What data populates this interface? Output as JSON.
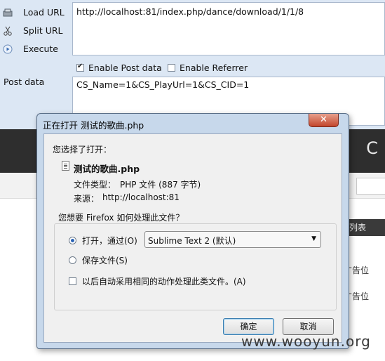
{
  "hackbar": {
    "items": [
      {
        "label": "Load URL"
      },
      {
        "label": "Split URL"
      },
      {
        "label": "Execute"
      }
    ],
    "url_value": "http://localhost:81/index.php/dance/download/1/1/8",
    "enable_post_label": "Enable Post data",
    "enable_post_checked": true,
    "enable_referrer_label": "Enable Referrer",
    "enable_referrer_checked": false,
    "post_label": "Post data",
    "post_value": "CS_Name=1&CS_PlayUrl=1&CS_CID=1"
  },
  "page": {
    "logo_partial": "S C",
    "tab_partial": "列表",
    "ad_1": "广告位",
    "ad_2": "广告位"
  },
  "dialog": {
    "title": "正在打开 测试的歌曲.php",
    "close_glyph": "✕",
    "choose_text": "您选择了打开：",
    "file_name": "测试的歌曲.php",
    "type_label": "文件类型：",
    "type_value": "PHP 文件 (887 字节)",
    "source_label": "来源：",
    "source_value": "http://localhost:81",
    "question": "您想要 Firefox 如何处理此文件？",
    "open_with_label": "打开，通过(O)",
    "open_with_selected": true,
    "app_selected": "Sublime Text 2 (默认)",
    "save_file_label": "保存文件(S)",
    "auto_action_label": "以后自动采用相同的动作处理此类文件。(A)",
    "auto_action_checked": false,
    "ok_label": "确定",
    "cancel_label": "取消"
  },
  "watermark": "www.wooyun.org",
  "colors": {
    "hackbar_bg": "#dce7f4",
    "dialog_frame": "#c7d8eb",
    "close_red": "#c2462c",
    "page_dark": "#2e2e2e"
  }
}
